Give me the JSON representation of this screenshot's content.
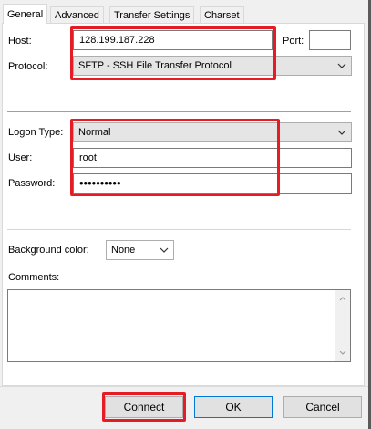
{
  "tabs": [
    {
      "label": "General",
      "active": true
    },
    {
      "label": "Advanced",
      "active": false
    },
    {
      "label": "Transfer Settings",
      "active": false
    },
    {
      "label": "Charset",
      "active": false
    }
  ],
  "general": {
    "host_label": "Host:",
    "host_value": "128.199.187.228",
    "port_label": "Port:",
    "port_value": "",
    "protocol_label": "Protocol:",
    "protocol_value": "SFTP - SSH File Transfer Protocol",
    "logon_type_label": "Logon Type:",
    "logon_type_value": "Normal",
    "user_label": "User:",
    "user_value": "root",
    "password_label": "Password:",
    "password_value": "••••••••••",
    "background_color_label": "Background color:",
    "background_color_value": "None",
    "comments_label": "Comments:",
    "comments_value": ""
  },
  "buttons": {
    "connect": "Connect",
    "ok": "OK",
    "cancel": "Cancel"
  },
  "colors": {
    "highlight": "#e51c23",
    "default_button_border": "#0078d7"
  }
}
